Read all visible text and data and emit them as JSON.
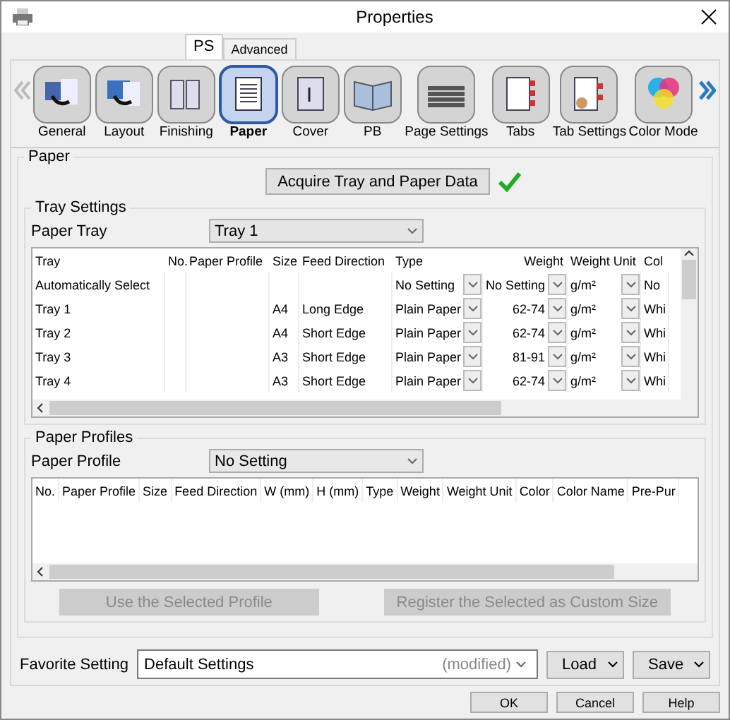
{
  "window": {
    "title": "Properties"
  },
  "tabs": [
    {
      "label": "PS",
      "selected": true
    },
    {
      "label": "Advanced",
      "selected": false
    }
  ],
  "functions": [
    {
      "label": "General",
      "selected": false
    },
    {
      "label": "Layout",
      "selected": false
    },
    {
      "label": "Finishing",
      "selected": false
    },
    {
      "label": "Paper",
      "selected": true
    },
    {
      "label": "Cover",
      "selected": false
    },
    {
      "label": "PB",
      "selected": false
    },
    {
      "label": "Page Settings",
      "selected": false
    },
    {
      "label": "Tabs",
      "selected": false
    },
    {
      "label": "Tab Settings",
      "selected": false
    },
    {
      "label": "Color Mode",
      "selected": false
    }
  ],
  "paper": {
    "title": "Paper",
    "acquire_button": "Acquire Tray and Paper Data",
    "tray_settings": {
      "title": "Tray Settings",
      "paper_tray_label": "Paper Tray",
      "paper_tray_value": "Tray 1",
      "columns": [
        "Tray",
        "No.",
        "Paper Profile",
        "Size",
        "Feed Direction",
        "Type",
        "Weight",
        "Weight Unit",
        "Col"
      ],
      "rows": [
        {
          "tray": "Automatically Select",
          "type": "No Setting",
          "weight": "No Setting",
          "weight_unit": "g/m²",
          "column_9": "No"
        },
        {
          "tray": "Tray 1",
          "size": "A4",
          "feed_direction": "Long Edge",
          "type": "Plain Paper",
          "weight": "62-74",
          "weight_unit": "g/m²",
          "column_9": "Whi"
        },
        {
          "tray": "Tray 2",
          "size": "A4",
          "feed_direction": "Short Edge",
          "type": "Plain Paper",
          "weight": "62-74",
          "weight_unit": "g/m²",
          "column_9": "Whi"
        },
        {
          "tray": "Tray 3",
          "size": "A3",
          "feed_direction": "Short Edge",
          "type": "Plain Paper",
          "weight": "81-91",
          "weight_unit": "g/m²",
          "column_9": "Whi"
        },
        {
          "tray": "Tray 4",
          "size": "A3",
          "feed_direction": "Short Edge",
          "type": "Plain Paper",
          "weight": "62-74",
          "weight_unit": "g/m²",
          "column_9": "Whi"
        }
      ]
    },
    "paper_profiles": {
      "title": "Paper Profiles",
      "paper_profile_label": "Paper Profile",
      "paper_profile_value": "No Setting",
      "columns": [
        "No.",
        "Paper Profile",
        "Size",
        "Feed Direction",
        "W (mm)",
        "H (mm)",
        "Type",
        "Weight",
        "Weight Unit",
        "Color",
        "Color Name",
        "Pre-Pur"
      ],
      "buttons": [
        {
          "label": "Use the Selected Profile",
          "disabled": true
        },
        {
          "label": "Register the Selected as Custom Size",
          "disabled": true
        }
      ]
    }
  },
  "favorite": {
    "label": "Favorite Setting",
    "value": "Default Settings",
    "modified": "(modified)",
    "load": "Load",
    "save": "Save"
  },
  "buttons": [
    "OK",
    "Cancel",
    "Help"
  ]
}
